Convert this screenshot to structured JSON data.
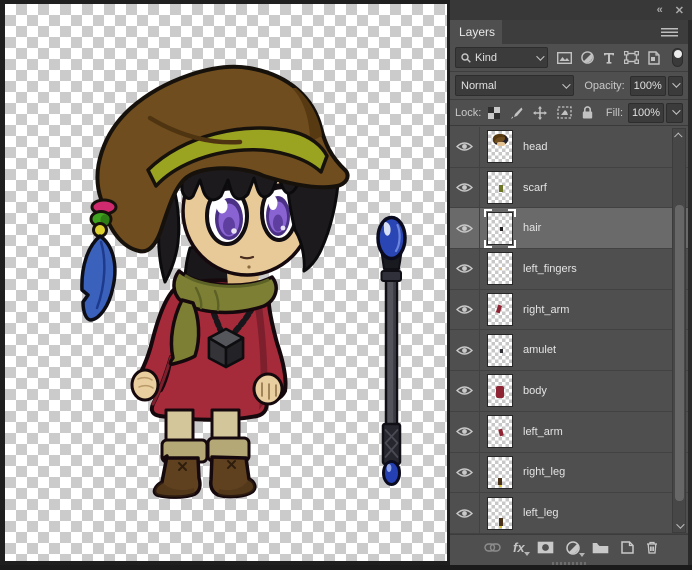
{
  "window": {
    "collapse_icon_glyph": "«",
    "close_icon_glyph": "✕"
  },
  "layers_panel": {
    "tab_label": "Layers",
    "filter": {
      "kind_label": "Kind"
    },
    "blend_mode_value": "Normal",
    "opacity_label": "Opacity:",
    "opacity_value": "100%",
    "lock_label": "Lock:",
    "fill_label": "Fill:",
    "fill_value": "100%",
    "fx_label": "fx",
    "filter_icon_names": [
      "pixel-layer-filter",
      "adjustment-layer-filter",
      "type-layer-filter",
      "shape-layer-filter",
      "smart-object-filter",
      "filter-toggle"
    ],
    "lock_icon_names": [
      "lock-transparent-pixels",
      "lock-image-pixels",
      "lock-position",
      "lock-artboard",
      "lock-all"
    ],
    "footer_icon_names": [
      "link-layers",
      "layer-styles-fx",
      "add-layer-mask",
      "new-adjustment-layer",
      "new-group",
      "new-layer",
      "delete-layer"
    ],
    "layers": [
      {
        "name": "head",
        "visible": true,
        "selected": false
      },
      {
        "name": "scarf",
        "visible": true,
        "selected": false
      },
      {
        "name": "hair",
        "visible": true,
        "selected": true
      },
      {
        "name": "left_fingers",
        "visible": true,
        "selected": false
      },
      {
        "name": "right_arm",
        "visible": true,
        "selected": false
      },
      {
        "name": "amulet",
        "visible": true,
        "selected": false
      },
      {
        "name": "body",
        "visible": true,
        "selected": false
      },
      {
        "name": "left_arm",
        "visible": true,
        "selected": false
      },
      {
        "name": "right_leg",
        "visible": true,
        "selected": false
      },
      {
        "name": "left_leg",
        "visible": true,
        "selected": false
      }
    ]
  },
  "canvas": {
    "content": "chibi witch character with brown hat, purple eyes, red robe, green scarf, cube amulet and blue-orb staff on transparent checkerboard",
    "colors": {
      "hat_brown": "#6f4d1e",
      "hat_band_olive": "#9aa421",
      "hair_black": "#1d1a1d",
      "skin": "#e8c998",
      "eye_purple": "#8a63d2",
      "robe_red": "#a62b3a",
      "scarf_olive": "#7d8034",
      "boot_brown": "#6b4a27",
      "staff_orb_blue": "#2a46b5",
      "checker_gray": "#cbcbcb",
      "panel_gray": "#4f4f4f",
      "selected_row": "#6a6a6a"
    }
  }
}
